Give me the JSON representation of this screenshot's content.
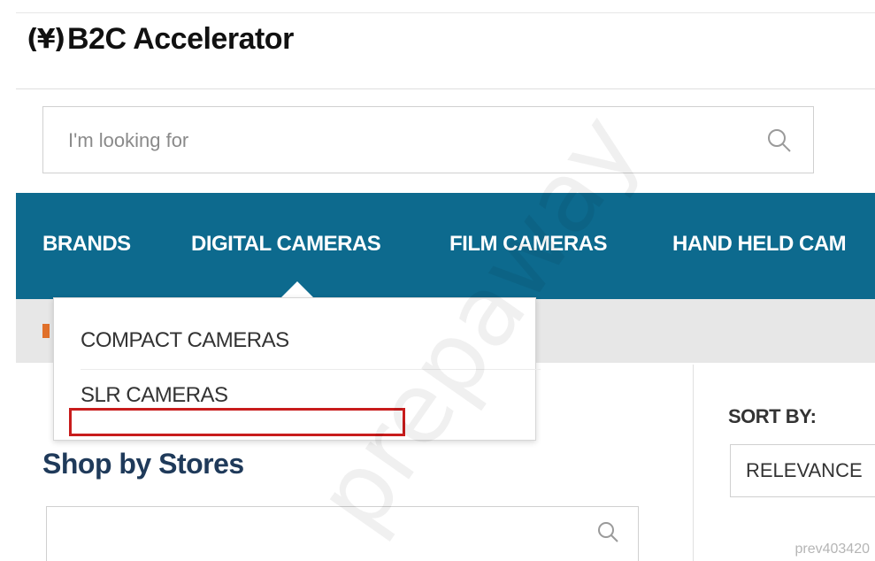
{
  "header": {
    "logo_mark": "(¥)",
    "logo_text": "B2C Accelerator"
  },
  "search": {
    "placeholder": "I'm looking for",
    "icon": "search-icon"
  },
  "nav": {
    "items": [
      "BRANDS",
      "DIGITAL CAMERAS",
      "FILM CAMERAS",
      "HAND HELD CAM"
    ]
  },
  "dropdown": {
    "items": [
      "COMPACT CAMERAS",
      "SLR CAMERAS"
    ]
  },
  "sidebar": {
    "title": "Shop by Stores",
    "search_icon": "search-icon"
  },
  "sort": {
    "label": "SORT BY:",
    "selected": "RELEVANCE"
  },
  "watermark": "prepaway",
  "corner_mark": "prev403420",
  "colors": {
    "nav_bg": "#0d6a8e",
    "highlight": "#c81c1c",
    "title_color": "#1f3a5a"
  }
}
